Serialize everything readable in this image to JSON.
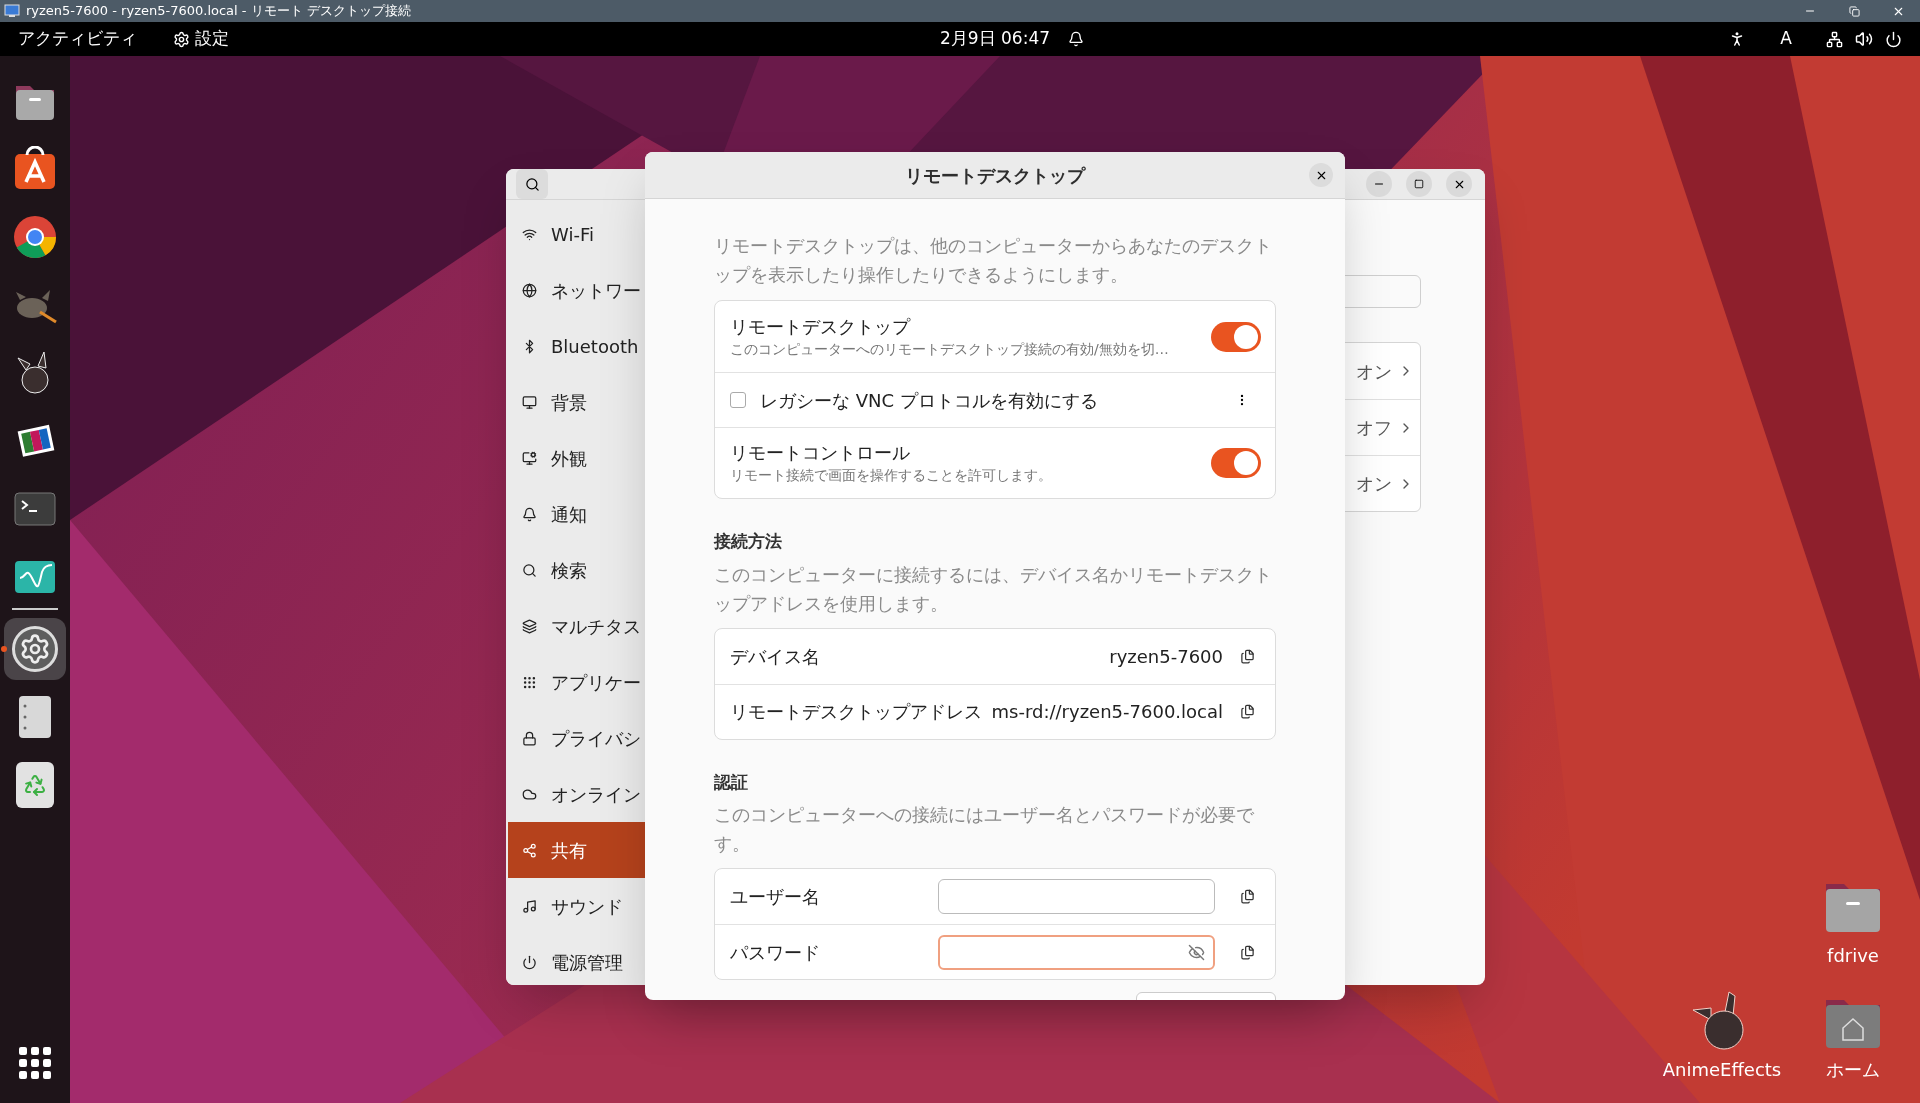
{
  "rdp_window": {
    "title": "ryzen5-7600 - ryzen5-7600.local - リモート デスクトップ接続"
  },
  "top_bar": {
    "activities": "アクティビティ",
    "app_menu": "設定",
    "clock": "2月9日 06:47",
    "input_method": "A"
  },
  "dock": {
    "items": [
      {
        "active": false
      },
      {
        "active": false
      },
      {
        "active": false
      },
      {
        "active": false
      },
      {
        "active": false
      },
      {
        "active": false
      },
      {
        "active": false
      },
      {
        "active": false
      },
      {
        "active": true
      },
      {
        "active": false
      },
      {
        "active": false
      }
    ]
  },
  "settings_window": {
    "sidebar": [
      {
        "label": "Wi-Fi",
        "selected": false
      },
      {
        "label": "ネットワー",
        "selected": false
      },
      {
        "label": "Bluetooth",
        "selected": false
      },
      {
        "label": "背景",
        "selected": false
      },
      {
        "label": "外観",
        "selected": false
      },
      {
        "label": "通知",
        "selected": false
      },
      {
        "label": "検索",
        "selected": false
      },
      {
        "label": "マルチタス",
        "selected": false
      },
      {
        "label": "アプリケー",
        "selected": false
      },
      {
        "label": "プライバシ",
        "selected": false
      },
      {
        "label": "オンライン",
        "selected": false
      },
      {
        "label": "共有",
        "selected": true
      },
      {
        "label": "サウンド",
        "selected": false
      },
      {
        "label": "電源管理",
        "selected": false
      }
    ],
    "rows": [
      {
        "value": "オン"
      },
      {
        "value": "オフ"
      },
      {
        "value": "オン"
      }
    ]
  },
  "dialog": {
    "title": "リモートデスクトップ",
    "description": "リモートデスクトップは、他のコンピューターからあなたのデスクトップを表示したり操作したりできるようにします。",
    "switches": [
      {
        "kind": "toggle",
        "title": "リモートデスクトップ",
        "subtitle": "このコンピューターへのリモートデスクトップ接続の有効/無効を切…",
        "on": true
      },
      {
        "kind": "checkbox",
        "title": "レガシーな VNC プロトコルを有効にする",
        "checked": false
      },
      {
        "kind": "toggle",
        "title": "リモートコントロール",
        "subtitle": "リモート接続で画面を操作することを許可します。",
        "on": true
      }
    ],
    "sections": [
      {
        "heading": "接続方法",
        "description": "このコンピューターに接続するには、デバイス名かリモートデスクトップアドレスを使用します。",
        "rows": [
          {
            "kind": "info",
            "label": "デバイス名",
            "value": "ryzen5-7600"
          },
          {
            "kind": "info",
            "label": "リモートデスクトップアドレス",
            "value": "ms-rd://ryzen5-7600.local"
          }
        ]
      },
      {
        "heading": "認証",
        "description": "このコンピューターへの接続にはユーザー名とパスワードが必要です。",
        "rows": [
          {
            "kind": "entry",
            "label": "ユーザー名",
            "focused": false
          },
          {
            "kind": "password",
            "label": "パスワード",
            "focused": true
          }
        ]
      }
    ]
  },
  "desktop_icons": [
    {
      "kind": "folder",
      "label": "fdrive"
    },
    {
      "kind": "app",
      "label": "AnimeEffects"
    },
    {
      "kind": "home",
      "label": "ホーム"
    }
  ]
}
